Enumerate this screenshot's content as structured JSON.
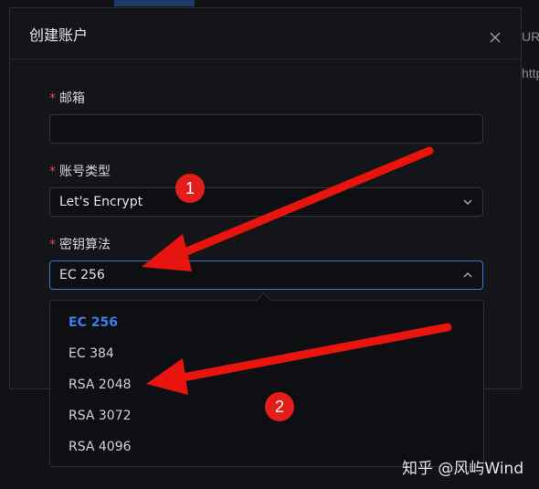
{
  "background": {
    "col_text_top": "URL",
    "col_text_row": "http"
  },
  "dialog": {
    "title": "创建账户",
    "fields": {
      "email": {
        "required_mark": "*",
        "label": "邮箱",
        "value": ""
      },
      "account_type": {
        "required_mark": "*",
        "label": "账号类型",
        "value": "Let's Encrypt"
      },
      "key_algorithm": {
        "required_mark": "*",
        "label": "密钥算法",
        "value": "EC 256"
      }
    }
  },
  "dropdown": {
    "options": [
      "EC 256",
      "EC 384",
      "RSA 2048",
      "RSA 3072",
      "RSA 4096"
    ],
    "selected": "EC 256"
  },
  "annotations": {
    "badge1": "1",
    "badge2": "2",
    "arrow_color": "#e8140e"
  },
  "watermark": "知乎 @风屿Wind",
  "colors": {
    "accent": "#3d7ee9",
    "required": "#f04646"
  }
}
